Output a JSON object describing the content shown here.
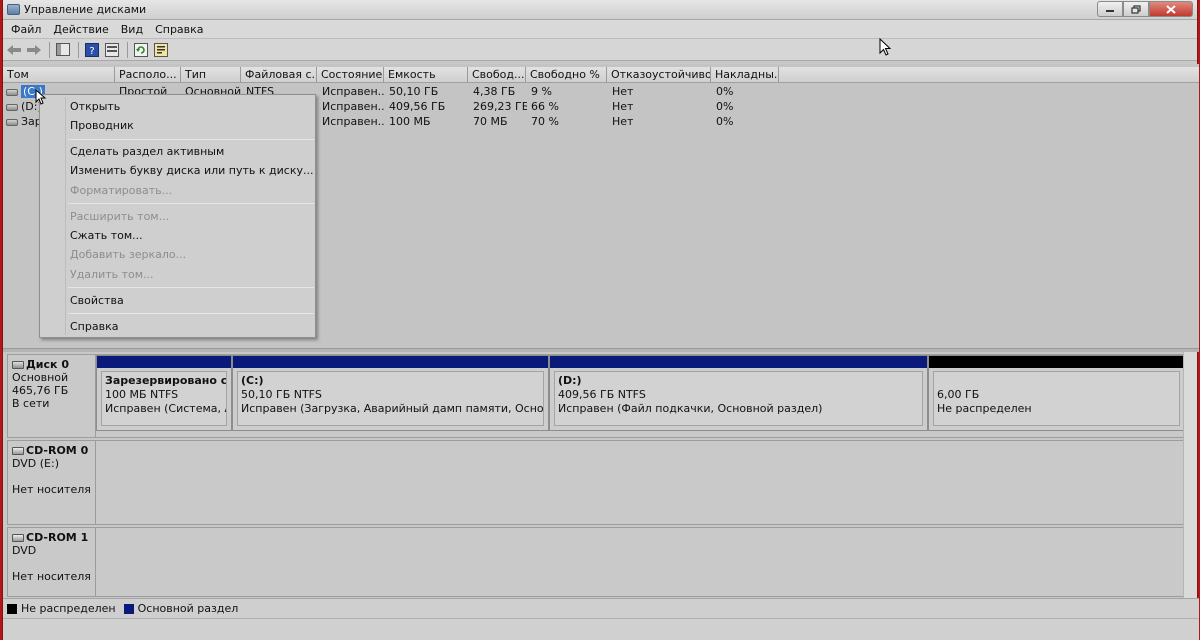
{
  "window": {
    "title": "Управление дисками"
  },
  "menu": [
    "Файл",
    "Действие",
    "Вид",
    "Справка"
  ],
  "toolbar": {
    "icons": [
      "back-arrow-icon",
      "forward-arrow-icon",
      "show-pane-icon",
      "help-icon",
      "refresh-icon",
      "properties-icon"
    ]
  },
  "volume_list": {
    "columns": [
      "Том",
      "Располо...",
      "Тип",
      "Файловая с...",
      "Состояние",
      "Емкость",
      "Свобод...",
      "Свободно %",
      "Отказоустойчиво...",
      "Накладны..."
    ],
    "rows": [
      {
        "name": "(C:)",
        "layout": "Простой",
        "type": "Основной",
        "fs": "NTFS",
        "status": "Исправен...",
        "capacity": "50,10 ГБ",
        "free": "4,38 ГБ",
        "free_pct": "9 %",
        "fault": "Нет",
        "overhead": "0%"
      },
      {
        "name": "(D:)",
        "layout": "",
        "type": "",
        "fs": "",
        "status": "Исправен...",
        "capacity": "409,56 ГБ",
        "free": "269,23 ГБ",
        "free_pct": "66 %",
        "fault": "Нет",
        "overhead": "0%"
      },
      {
        "name": "Зар",
        "layout": "",
        "type": "",
        "fs": "",
        "status": "Исправен...",
        "capacity": "100 МБ",
        "free": "70 МБ",
        "free_pct": "70 %",
        "fault": "Нет",
        "overhead": "0%"
      }
    ]
  },
  "context_menu": {
    "items": [
      {
        "label": "Открыть",
        "enabled": true
      },
      {
        "label": "Проводник",
        "enabled": true
      },
      {
        "label": "Сделать раздел активным",
        "enabled": true
      },
      {
        "label": "Изменить букву диска или путь к диску...",
        "enabled": true
      },
      {
        "label": "Форматировать...",
        "enabled": false
      },
      {
        "label": "Расширить том...",
        "enabled": false
      },
      {
        "label": "Сжать том...",
        "enabled": true
      },
      {
        "label": "Добавить зеркало...",
        "enabled": false
      },
      {
        "label": "Удалить том...",
        "enabled": false
      },
      {
        "label": "Свойства",
        "enabled": true
      },
      {
        "label": "Справка",
        "enabled": true
      }
    ]
  },
  "disks": [
    {
      "name": "Диск 0",
      "type": "Основной",
      "size": "465,76 ГБ",
      "state": "В сети",
      "partitions": [
        {
          "title": "Зарезервировано систе",
          "size": "100 МБ NTFS",
          "status": "Исправен (Система, Акти",
          "color": "#0a1a7a"
        },
        {
          "title": "(C:)",
          "size": "50,10 ГБ NTFS",
          "status": "Исправен (Загрузка, Аварийный дамп памяти, Основной разде",
          "color": "#0a1a7a"
        },
        {
          "title": "(D:)",
          "size": "409,56 ГБ NTFS",
          "status": "Исправен (Файл подкачки, Основной раздел)",
          "color": "#0a1a7a"
        },
        {
          "title": "",
          "size": "6,00 ГБ",
          "status": "Не распределен",
          "color": "#000000"
        }
      ]
    },
    {
      "name": "CD-ROM 0",
      "type": "DVD (E:)",
      "state": "Нет носителя"
    },
    {
      "name": "CD-ROM 1",
      "type": "DVD",
      "state": "Нет носителя"
    }
  ],
  "legend": [
    {
      "label": "Не распределен",
      "color": "#000000"
    },
    {
      "label": "Основной раздел",
      "color": "#0a1a7a"
    }
  ]
}
